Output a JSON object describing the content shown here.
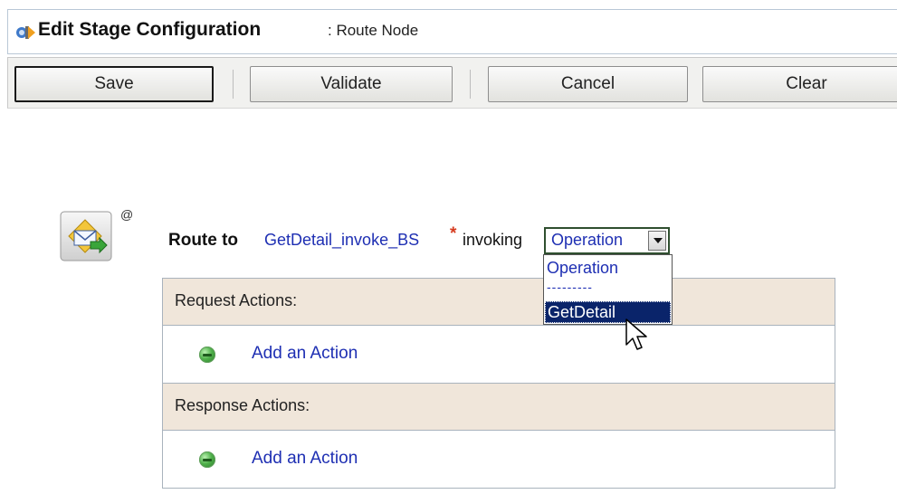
{
  "header": {
    "title": "Edit Stage Configuration",
    "subtitle": ": Route Node"
  },
  "toolbar": {
    "save_label": "Save",
    "validate_label": "Validate",
    "cancel_label": "Cancel",
    "clear_label": "Clear"
  },
  "route": {
    "label": "Route to",
    "target": "GetDetail_invoke_BS",
    "required_marker": "*",
    "invoking": "invoking",
    "at_sign": "@"
  },
  "operation_select": {
    "value": "Operation",
    "options": [
      "Operation",
      "---------",
      "GetDetail"
    ],
    "highlighted": "GetDetail"
  },
  "request_actions": {
    "header": "Request Actions:",
    "add_label": "Add an Action"
  },
  "response_actions": {
    "header": "Response Actions:",
    "add_label": "Add an Action"
  },
  "icons": {
    "header": "stage-config-icon",
    "stage": "route-envelope-icon",
    "add": "add-action-icon",
    "cursor": "mouse-pointer-icon"
  },
  "colors": {
    "link": "#1e2fb3",
    "section_header_bg": "#f0e6da",
    "selected_option_bg": "#0a246a",
    "required_star": "#d63b1f"
  }
}
